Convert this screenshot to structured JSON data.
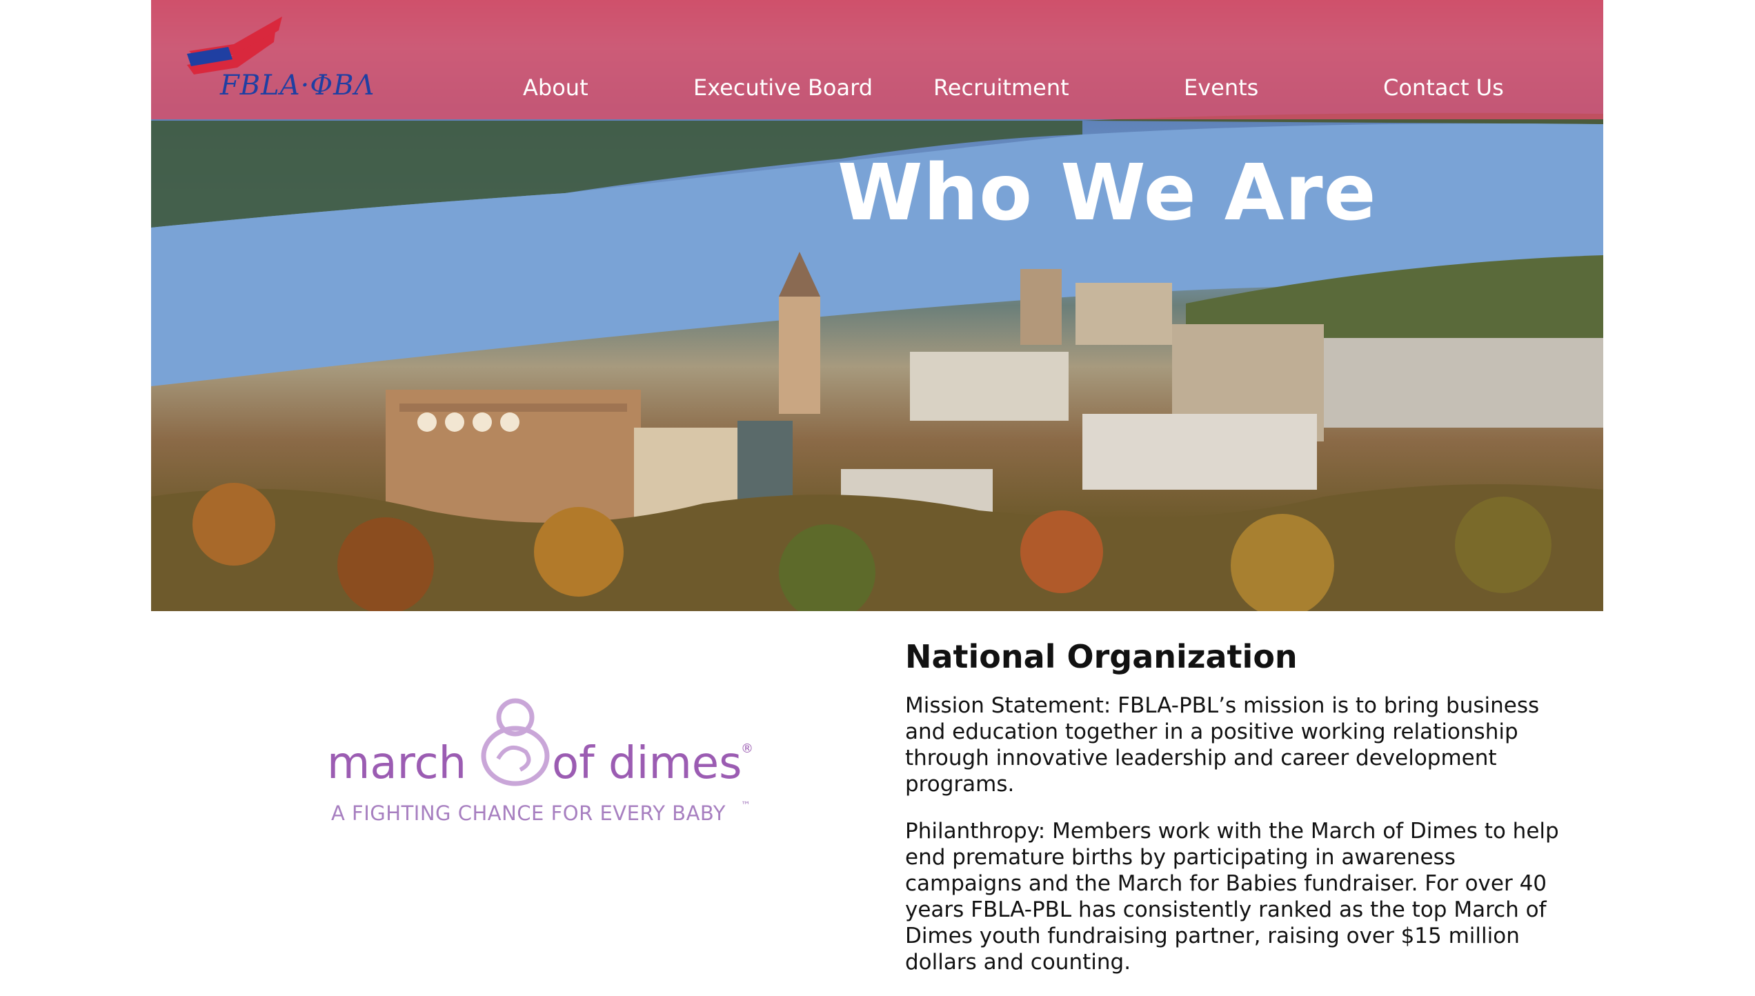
{
  "brand": {
    "logo_text": "FBLA·ΦΒΛ"
  },
  "nav": {
    "items": [
      {
        "label": "About"
      },
      {
        "label": "Executive Board"
      },
      {
        "label": "Recruitment"
      },
      {
        "label": "Events"
      },
      {
        "label": "Contact Us"
      }
    ]
  },
  "hero": {
    "title": "Who We Are"
  },
  "sponsor": {
    "word_left": "march",
    "word_right": "of dimes",
    "registered": "®",
    "tagline": "A FIGHTING CHANCE FOR EVERY BABY",
    "tm": "™"
  },
  "section": {
    "heading": "National Organization",
    "paragraphs": [
      "Mission Statement: FBLA-PBL’s mission is to bring business and education together in a positive working relationship through innovative leadership and career development programs.",
      "Philanthropy: Members work with the March of Dimes to help end premature births by participating in awareness campaigns and the March for Babies fundraiser. For over 40 years FBLA-PBL has consistently ranked as the top March of Dimes youth fundraising partner, raising over $15 million dollars and counting."
    ]
  },
  "colors": {
    "navbar": "#db4e68",
    "brand_blue": "#1f3fa2",
    "march_of_dimes_purple": "#9b5cb2"
  }
}
